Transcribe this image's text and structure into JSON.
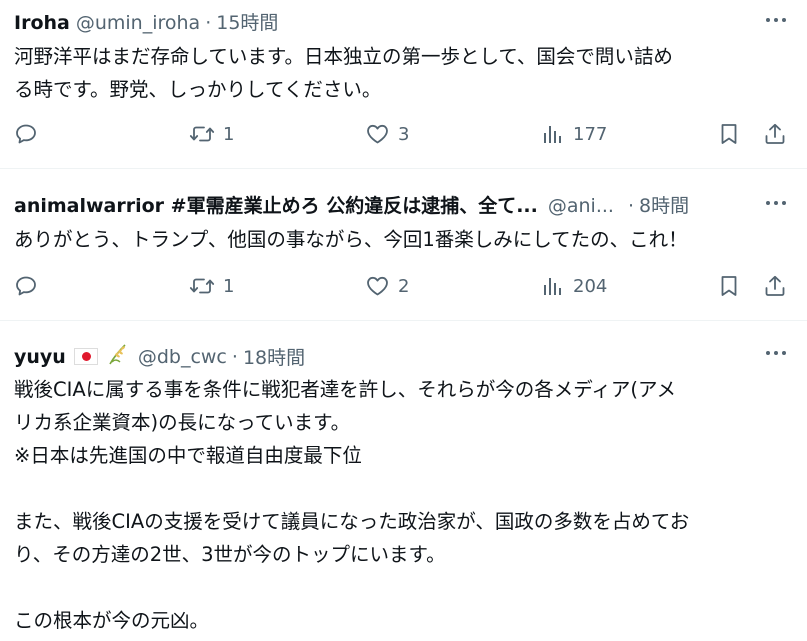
{
  "tweets": [
    {
      "name": "Iroha",
      "handle": "@umin_iroha",
      "separator": "·",
      "time": "15時間",
      "lines": [
        "河野洋平はまだ存命しています。日本独立の第一歩として、国会で問い詰め",
        "る時です。野党、しっかりしてください。"
      ],
      "retweets": "1",
      "likes": "3",
      "views": "177"
    },
    {
      "name": "animalwarrior #軍需産業止めろ 公約違反は逮捕、全て...",
      "handle": "@ani...",
      "separator": "·",
      "time": "8時間",
      "lines": [
        "ありがとう、トランプ、他国の事ながら、今回1番楽しみにしてたの、これ！"
      ],
      "retweets": "1",
      "likes": "2",
      "views": "204"
    },
    {
      "name": "yuyu",
      "handle": "@db_cwc",
      "separator": "·",
      "time": "18時間",
      "lines": [
        "戦後CIAに属する事を条件に戦犯者達を許し、それらが今の各メディア(アメ",
        "リカ系企業資本)の長になっています。",
        "※日本は先進国の中で報道自由度最下位",
        "",
        "また、戦後CIAの支援を受けて議員になった政治家が、国政の多数を占めてお",
        "り、その方達の2世、3世が今のトップにいます。",
        "",
        "この根本が今の元凶。"
      ]
    }
  ],
  "icons": {
    "more": "more-horizontal-icon",
    "reply": "reply-icon",
    "retweet": "retweet-icon",
    "like": "heart-icon",
    "views": "bar-chart-icon",
    "bookmark": "bookmark-icon",
    "share": "share-icon",
    "flag": "japan-flag-emoji",
    "rice": "rice-plant-emoji"
  },
  "colors": {
    "text": "#0f1419",
    "secondary": "#536471",
    "divider": "#eff3f4",
    "flag_red": "#e0182d"
  }
}
